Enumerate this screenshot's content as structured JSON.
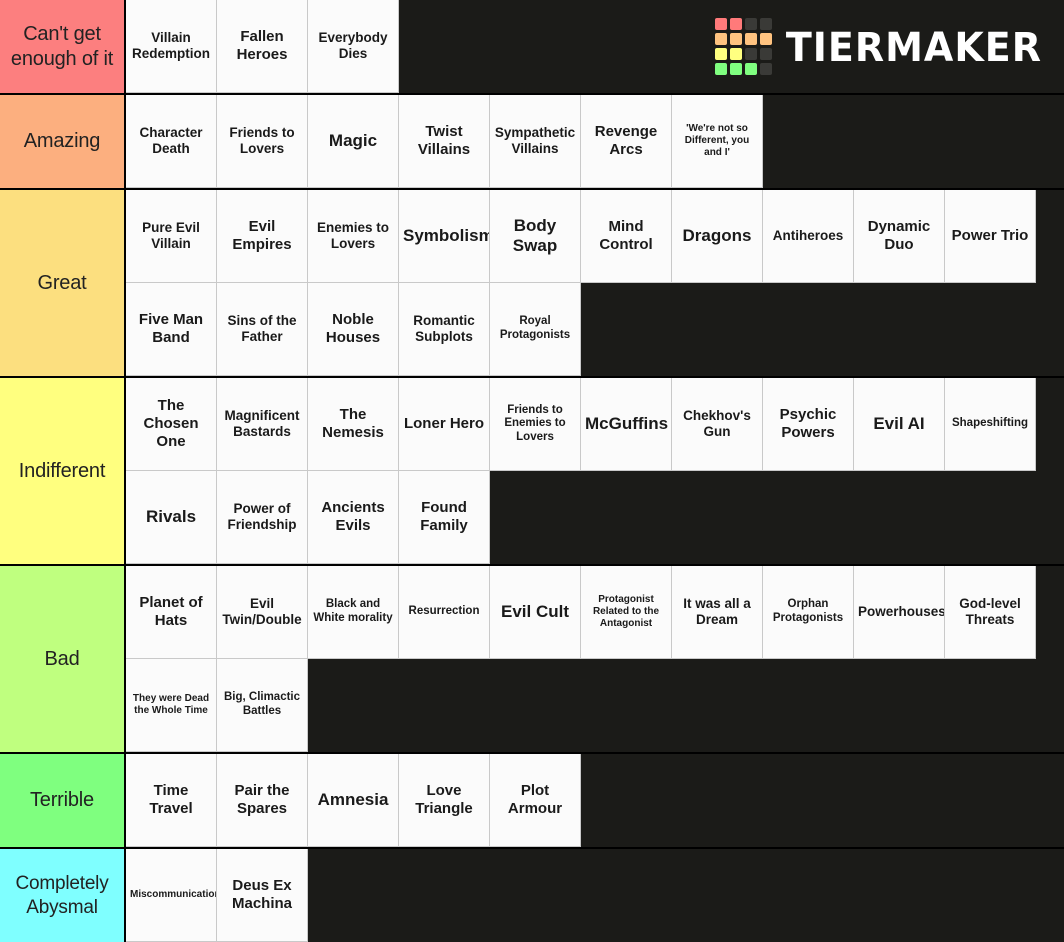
{
  "brand": {
    "name": "TIERMAKER",
    "logo_colors": {
      "red": "#ff7a7a",
      "orange": "#ffc380",
      "yellow": "#ffff80",
      "green": "#80ff80",
      "empty": "#3a3a37"
    },
    "logo_grid": [
      [
        "red",
        "red",
        "empty",
        "empty"
      ],
      [
        "orange",
        "orange",
        "orange",
        "orange"
      ],
      [
        "yellow",
        "yellow",
        "empty",
        "empty"
      ],
      [
        "green",
        "green",
        "green",
        "empty"
      ]
    ]
  },
  "background_color": "#1b1b18",
  "tiers": [
    {
      "label": "Can't get enough of it",
      "color": "#fc7f7f",
      "items": [
        "Villain Redemption",
        "Fallen Heroes",
        "Everybody Dies"
      ]
    },
    {
      "label": "Amazing",
      "color": "#fcaf7f",
      "items": [
        "Character Death",
        "Friends to Lovers",
        "Magic",
        "Twist Villains",
        "Sympathetic Villains",
        "Revenge Arcs",
        "'We're not so Different, you and I'"
      ]
    },
    {
      "label": "Great",
      "color": "#fcdf7f",
      "items": [
        "Pure Evil Villain",
        "Evil Empires",
        "Enemies to Lovers",
        "Symbolism",
        "Body Swap",
        "Mind Control",
        "Dragons",
        "Antiheroes",
        "Dynamic Duo",
        "Power Trio",
        "Five Man Band",
        "Sins of the Father",
        "Noble Houses",
        "Romantic Subplots",
        "Royal Protagonists"
      ]
    },
    {
      "label": "Indifferent",
      "color": "#ffff7f",
      "items": [
        "The Chosen One",
        "Magnificent Bastards",
        "The Nemesis",
        "Loner Hero",
        "Friends to Enemies to Lovers",
        "McGuffins",
        "Chekhov's Gun",
        "Psychic Powers",
        "Evil AI",
        "Shapeshifting",
        "Rivals",
        "Power of Friendship",
        "Ancients Evils",
        "Found Family"
      ]
    },
    {
      "label": "Bad",
      "color": "#bfff7f",
      "items": [
        "Planet of Hats",
        "Evil Twin/Double",
        "Black and White morality",
        "Resurrection",
        "Evil Cult",
        "Protagonist Related to the Antagonist",
        "It was all a Dream",
        "Orphan Protagonists",
        "Powerhouses",
        "God-level Threats",
        "They were Dead the Whole Time",
        "Big, Climactic Battles"
      ]
    },
    {
      "label": "Terrible",
      "color": "#7fff7f",
      "items": [
        "Time Travel",
        "Pair the Spares",
        "Amnesia",
        "Love Triangle",
        "Plot Armour"
      ]
    },
    {
      "label": "Completely Abysmal",
      "color": "#7fffff",
      "items": [
        "Miscommunication",
        "Deus Ex Machina"
      ]
    }
  ]
}
